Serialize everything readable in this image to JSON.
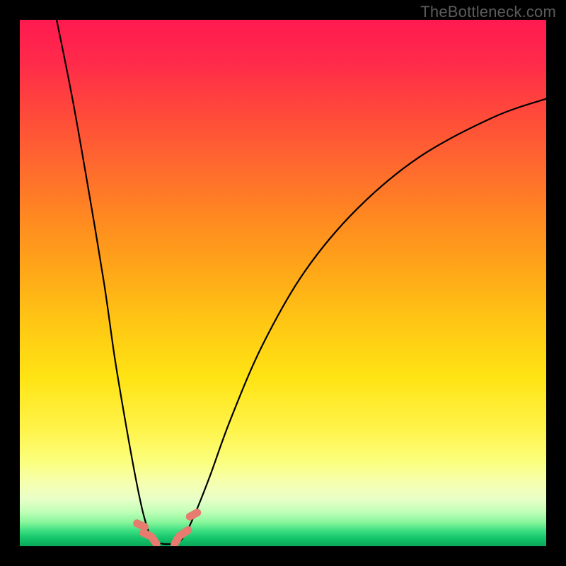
{
  "watermark": "TheBottleneck.com",
  "colors": {
    "frame": "#000000",
    "curve": "#000000",
    "marker": "#e77b70",
    "gradient_top": "#ff1a50",
    "gradient_mid": "#ffe414",
    "gradient_bottom": "#0aa85a"
  },
  "chart_data": {
    "type": "line",
    "title": "",
    "xlabel": "",
    "ylabel": "",
    "xlim": [
      0,
      100
    ],
    "ylim": [
      0,
      100
    ],
    "grid": false,
    "legend": false,
    "annotations": [
      "TheBottleneck.com"
    ],
    "series": [
      {
        "name": "left-branch",
        "x": [
          7,
          10,
          13,
          16,
          18,
          20,
          22,
          23.5,
          25
        ],
        "y": [
          100,
          85,
          68,
          50,
          36,
          24,
          13,
          6,
          1.5
        ]
      },
      {
        "name": "trough",
        "x": [
          25,
          26.5,
          28,
          29.5,
          31
        ],
        "y": [
          1.5,
          0.6,
          0.4,
          0.6,
          1.6
        ]
      },
      {
        "name": "right-branch",
        "x": [
          31,
          33,
          36,
          40,
          46,
          54,
          64,
          76,
          90,
          100
        ],
        "y": [
          1.6,
          5.5,
          13,
          24,
          38,
          52,
          64,
          74,
          81.5,
          85
        ]
      }
    ],
    "markers": {
      "name": "trough-markers",
      "points": [
        {
          "x": 23.0,
          "y": 4.0
        },
        {
          "x": 24.2,
          "y": 2.2
        },
        {
          "x": 25.5,
          "y": 1.1
        },
        {
          "x": 29.8,
          "y": 1.1
        },
        {
          "x": 31.3,
          "y": 2.6
        },
        {
          "x": 33.0,
          "y": 6.0
        }
      ]
    }
  }
}
